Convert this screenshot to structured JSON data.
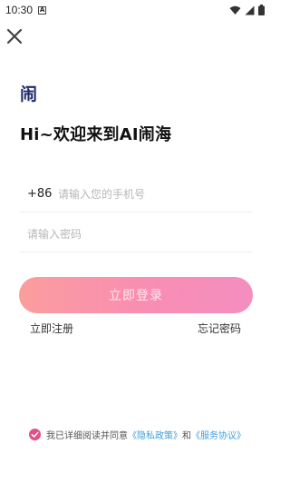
{
  "status_bar": {
    "time": "10:30",
    "notification_icon": "a-icon",
    "icons": [
      "wifi-icon",
      "signal-icon",
      "battery-icon"
    ]
  },
  "header": {
    "close_icon": "close-icon",
    "logo_text": "闹"
  },
  "welcome": {
    "title": "Hi~欢迎来到AI闹海"
  },
  "form": {
    "country_code": "+86",
    "phone_placeholder": "请输入您的手机号",
    "password_placeholder": "请输入密码",
    "login_label": "立即登录"
  },
  "links": {
    "register": "立即注册",
    "forgot_password": "忘记密码"
  },
  "agreement": {
    "prefix": "我已详细阅读并同意",
    "privacy_policy": "《隐私政策》",
    "and": "和",
    "service_agreement": "《服务协议》"
  },
  "colors": {
    "brand_navy": "#1f2a6b",
    "accent_pink": "#f98db3",
    "accent_coral": "#fb9d9d",
    "link_blue": "#3f9fd8",
    "check_pink": "#e0508a"
  }
}
